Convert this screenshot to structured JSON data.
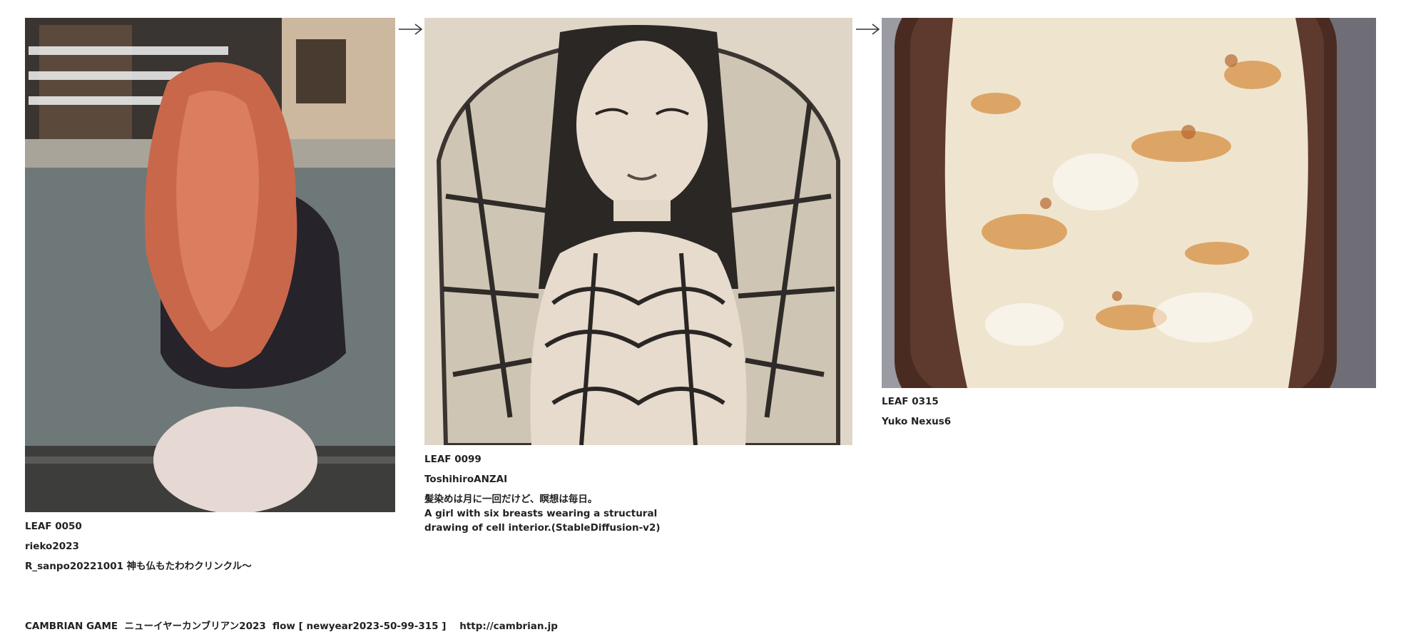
{
  "leaves": [
    {
      "id": "LEAF 0050",
      "author": "rieko2023",
      "caption": "R_sanpo20221001 神も仏もたわわクリンクル～"
    },
    {
      "id": "LEAF 0099",
      "author": "ToshihiroANZAI",
      "caption_line1": "髪染めは月に一回だけど、瞑想は毎日。",
      "caption_line2": "A girl with six breasts wearing a structural drawing of cell interior.(StableDiffusion-v2)"
    },
    {
      "id": "LEAF 0315",
      "author": "Yuko Nexus6"
    }
  ],
  "footer": "CAMBRIAN GAME  ニューイヤーカンブリアン2023  flow [ newyear2023-50-99-315 ]    http://cambrian.jp",
  "icons": [
    "right-arrow-icon",
    "right-arrow-icon"
  ]
}
